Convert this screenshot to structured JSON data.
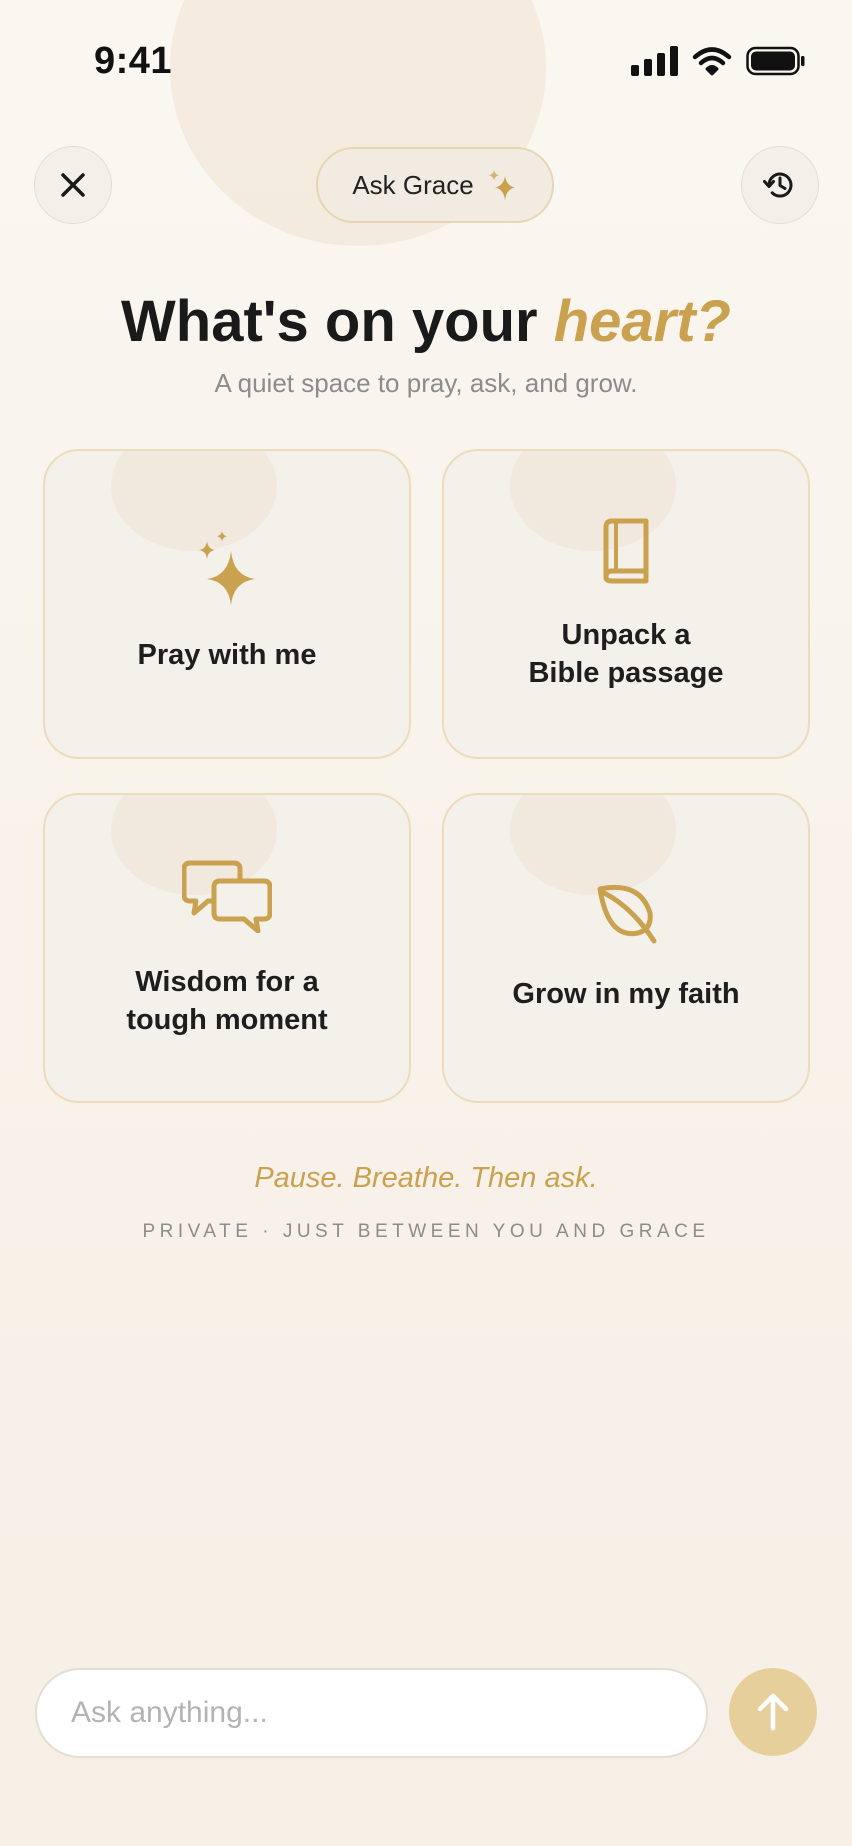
{
  "status_bar": {
    "time": "9:41"
  },
  "header": {
    "pill_label": "Ask Grace"
  },
  "hero": {
    "title_main": "What's on your ",
    "title_accent": "heart?",
    "subtitle": "A quiet space to pray, ask, and grow."
  },
  "cards": [
    {
      "label": "Pray with me",
      "icon": "sparkles-icon"
    },
    {
      "label": "Unpack a\nBible passage",
      "icon": "book-icon"
    },
    {
      "label": "Wisdom for a\ntough moment",
      "icon": "chat-bubbles-icon"
    },
    {
      "label": "Grow in my faith",
      "icon": "leaf-icon"
    }
  ],
  "footer": {
    "tagline": "Pause. Breathe. Then ask.",
    "privacy": "PRIVATE · JUST BETWEEN YOU AND GRACE"
  },
  "composer": {
    "placeholder": "Ask anything..."
  },
  "colors": {
    "accent": "#c9a14f",
    "send_button": "#e7cf9c"
  }
}
